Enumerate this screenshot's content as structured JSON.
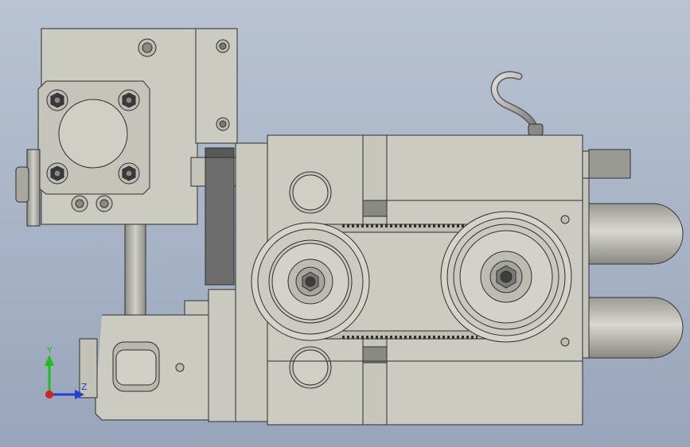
{
  "view": {
    "background_top": "#b9c3d3",
    "background_bottom": "#98a5ba",
    "part_fill": "#cbcbc1",
    "part_edge": "#2e2e2e",
    "shadow_fill": "#6d6d6d"
  },
  "triad": {
    "y_label": "Y",
    "z_label": "Z",
    "y_color": "#1fbf1f",
    "z_color": "#1f3fd8",
    "x_color": "#d81f1f"
  }
}
